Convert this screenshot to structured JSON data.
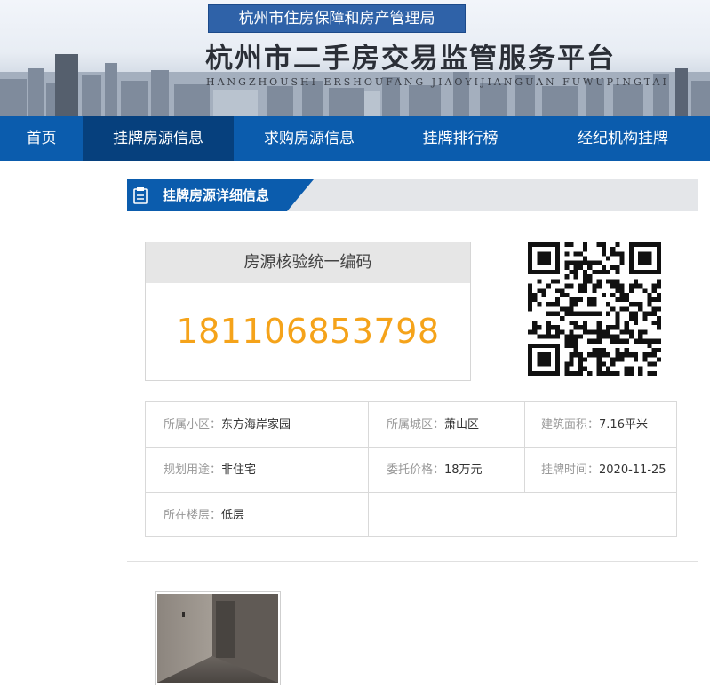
{
  "header": {
    "bureau": "杭州市住房保障和房产管理局",
    "title": "杭州市二手房交易监管服务平台",
    "subtitle": "HANGZHOUSHI  ERSHOUFANG  JIAOYIJIANGUAN  FUWUPINGTAI"
  },
  "nav": {
    "items": [
      {
        "label": "首页"
      },
      {
        "label": "挂牌房源信息"
      },
      {
        "label": "求购房源信息"
      },
      {
        "label": "挂牌排行榜"
      },
      {
        "label": "经纪机构挂牌"
      }
    ],
    "active_index": 1
  },
  "section": {
    "title": "挂牌房源详细信息"
  },
  "verification": {
    "label": "房源核验统一编码",
    "code": "181106853798"
  },
  "info": {
    "community_label": "所属小区：",
    "community": "东方海岸家园",
    "district_label": "所属城区：",
    "district": "萧山区",
    "area_label": "建筑面积：",
    "area": "7.16平米",
    "usage_label": "规划用途：",
    "usage": "非住宅",
    "price_label": "委托价格：",
    "price": "18万元",
    "listed_label": "挂牌时间：",
    "listed": "2020-11-25",
    "floor_label": "所在楼层：",
    "floor": "低层"
  },
  "colors": {
    "nav": "#0b5cad",
    "nav_active": "#06407d",
    "code": "#f5a31a",
    "bureau_badge": "#2f62a8"
  },
  "icons": {
    "section": "document-icon",
    "qr": "qr-code-icon"
  }
}
